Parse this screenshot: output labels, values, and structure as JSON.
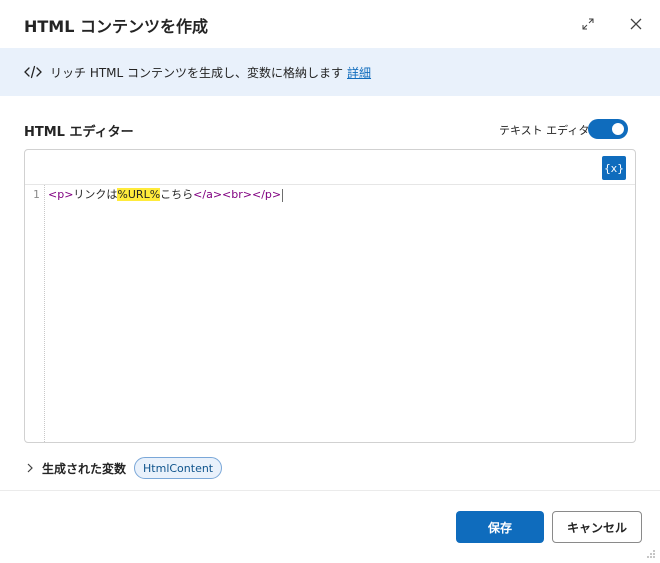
{
  "dialog": {
    "title": "HTML コンテンツを作成",
    "expand_icon": "expand-icon",
    "close_icon": "close-icon"
  },
  "banner": {
    "icon": "code-icon",
    "description": "リッチ HTML コンテンツを生成し、変数に格納します",
    "link_label": "詳細"
  },
  "editor": {
    "label": "HTML エディター",
    "toggle_label": "テキスト エディター",
    "toggle_on": true,
    "variable_button_label": "{x}",
    "line_number": "1",
    "code": {
      "p_open": "<p>",
      "text_before": "リンクは",
      "variable": "%URL%",
      "text_after": "こちら",
      "a_close": "</a>",
      "br": "<br>",
      "p_close": "</p>"
    }
  },
  "generated_variables": {
    "label": "生成された変数",
    "chip": "HtmlContent"
  },
  "footer": {
    "save_label": "保存",
    "cancel_label": "キャンセル"
  },
  "colors": {
    "accent": "#0f6cbd",
    "banner_bg": "#e9f1fb",
    "tag": "#800080",
    "highlight": "#ffeb3b"
  }
}
